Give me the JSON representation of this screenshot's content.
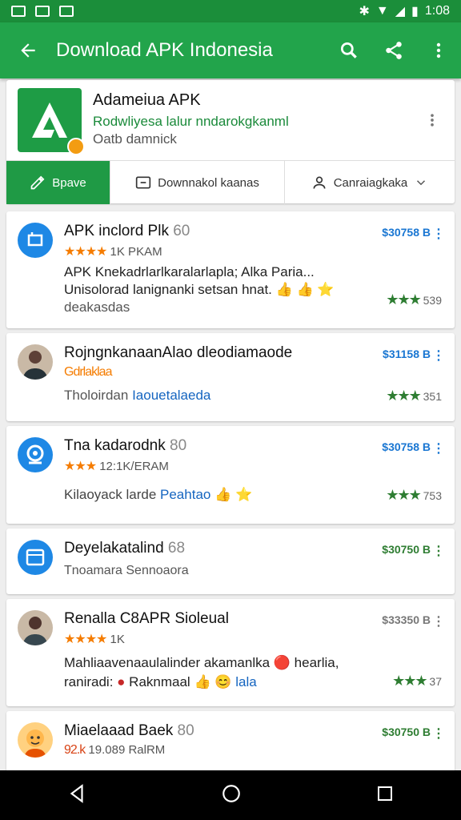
{
  "status": {
    "time": "1:08"
  },
  "appbar": {
    "title": "Download APK Indonesia"
  },
  "header": {
    "name": "Adameiua APK",
    "subtitle": "Rodwliyesa lalur nndarokgkanml",
    "subtitle2": "Oatb damnick",
    "tabs": [
      "Bpave",
      "Downnakol kaanas",
      "Canraiagkaka"
    ]
  },
  "items": [
    {
      "title": "APK inclord Plk",
      "num": "60",
      "stars": "★★★★",
      "meta": "1K PKAM",
      "body1": "APK Knekadrlarlkaralarlapla; Alka Paria...",
      "body2": "Unisolorad lanignanki setsan hnat. 👍 👍 ⭐",
      "body3": "deakasdas",
      "price": "$30758 B",
      "rating_stars": "★★★",
      "rating": "539",
      "price_color": "blue"
    },
    {
      "title": "RojngnkanaanAlao dleodiamaode",
      "num": "",
      "stars": "",
      "meta": "Gdrlaklaa",
      "body1": "Tholoirdan",
      "body1_link": "Iaouetalaeda",
      "body2": "",
      "body3": "",
      "price": "$31158 B",
      "rating_stars": "★★★",
      "rating": "351",
      "price_color": "blue"
    },
    {
      "title": "Tna kadarodnk",
      "num": "80",
      "stars": "★★★",
      "meta": "12:1K/ERAM",
      "body1": "Kilaoyack larde",
      "body1_link": "Peahtao",
      "body2": "",
      "body3": "",
      "price": "$30758 B",
      "rating_stars": "★★★",
      "rating": "753",
      "price_color": "blue"
    },
    {
      "title": "Deyelakatalind",
      "num": "68",
      "stars": "",
      "meta": "Tnoamara  Sennoaora",
      "body1": "",
      "body1_link": "",
      "body2": "",
      "body3": "",
      "price": "$30750 B",
      "rating_stars": "",
      "rating": "",
      "price_color": "green"
    },
    {
      "title": "Renalla C8APR Sioleual",
      "num": "",
      "stars": "★★★★",
      "meta": "1K",
      "body1": "Mahliaavenaaulalinder akamanlka 🔴 hearlia,",
      "body2": "raniradi:",
      "body2_link": "Raknmaal",
      "body2_tail": "lala",
      "body3": "",
      "price": "$33350 B",
      "rating_stars": "★★★",
      "rating": "37",
      "price_color": "grey"
    },
    {
      "title": "Miaelaaad Baek",
      "num": "80",
      "stars": "",
      "meta": "19.089 RalRM",
      "meta_prefix": "92.k",
      "body1": "",
      "body2": "",
      "body3": "",
      "price": "$30750 B",
      "rating_stars": "",
      "rating": "",
      "price_color": "green"
    }
  ],
  "colors": {
    "primary": "#22a44b",
    "status": "#1b8e3a",
    "accent": "#f57c00",
    "link": "#1565c0"
  }
}
